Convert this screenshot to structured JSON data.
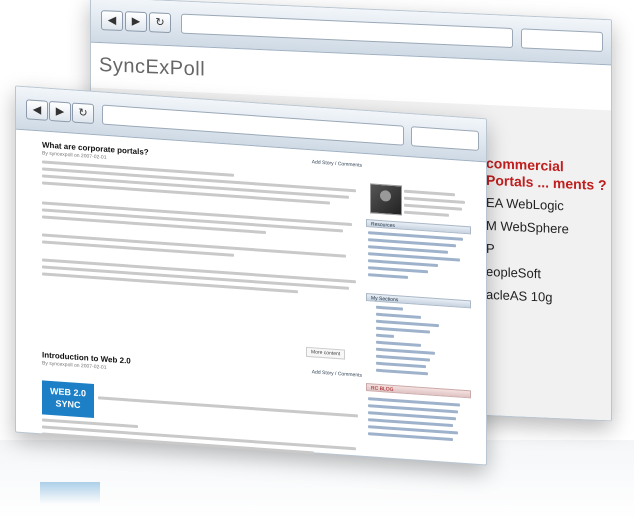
{
  "back_window": {
    "brand": "SyncExPoll",
    "portal_heading": "commercial Portals ... ments ?",
    "vendors": [
      "EA WebLogic",
      "M WebSphere",
      "P",
      "eopleSoft",
      "acleAS 10g"
    ]
  },
  "front_window": {
    "nav": {
      "back": "◀",
      "forward": "▶",
      "reload": "↻"
    },
    "articles": [
      {
        "title": "What are corporate portals?",
        "meta": "By syncexpoll on 2007-02-01",
        "link": "Add Story / Comments"
      },
      {
        "title": "Introduction to Web 2.0",
        "meta": "By syncexpoll on 2007-02-01",
        "link": "Add Story / Comments"
      }
    ],
    "more_label": "More content",
    "web20_logo": [
      "WEB 2.0",
      "SYNC"
    ],
    "side_headers": [
      "Resources",
      "My Sections",
      "RC BLOG"
    ]
  }
}
